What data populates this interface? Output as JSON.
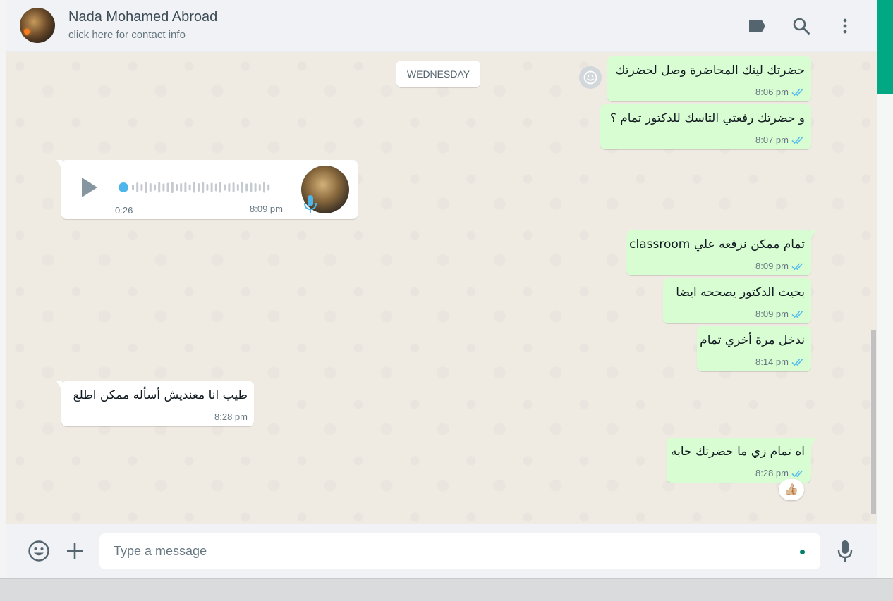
{
  "header": {
    "contact_name": "Nada Mohamed Abroad",
    "contact_sub": "click here for contact info",
    "icons": [
      "label-icon",
      "search-icon",
      "menu-icon"
    ]
  },
  "chat": {
    "date_chip": "WEDNESDAY",
    "messages": [
      {
        "direction": "out",
        "text": "حضرتك لينك المحاضرة وصل لحضرتك",
        "time": "8:06 pm",
        "status": "read"
      },
      {
        "direction": "out",
        "text": "و حضرتك رفعتي التاسك للدكتور تمام ؟",
        "time": "8:07 pm",
        "status": "read"
      },
      {
        "direction": "in",
        "type": "voice",
        "duration": "0:26",
        "time": "8:09 pm"
      },
      {
        "direction": "out",
        "text": "تمام ممكن نرفعه علي classroom",
        "time": "8:09 pm",
        "status": "read"
      },
      {
        "direction": "out",
        "text": "بحيث الدكتور يصححه ايضا",
        "time": "8:09 pm",
        "status": "read"
      },
      {
        "direction": "out",
        "text": "ندخل مرة أخري تمام",
        "time": "8:14 pm",
        "status": "read"
      },
      {
        "direction": "in",
        "text": "طيب انا معنديش أسأله ممكن اطلع",
        "time": "8:28 pm"
      },
      {
        "direction": "out",
        "text": "اه تمام زي ما حضرتك حابه",
        "time": "8:28 pm",
        "status": "read",
        "reaction": "👍🏼"
      }
    ]
  },
  "footer": {
    "input_placeholder": "Type a message",
    "icons": [
      "emoji-icon",
      "attach-plus-icon",
      "mic-icon"
    ]
  },
  "colors": {
    "accent": "#00a884",
    "outgoing_bubble": "#d9fdd3",
    "incoming_bubble": "#ffffff",
    "read_ticks": "#53bdeb",
    "chat_background": "#efeae2"
  }
}
